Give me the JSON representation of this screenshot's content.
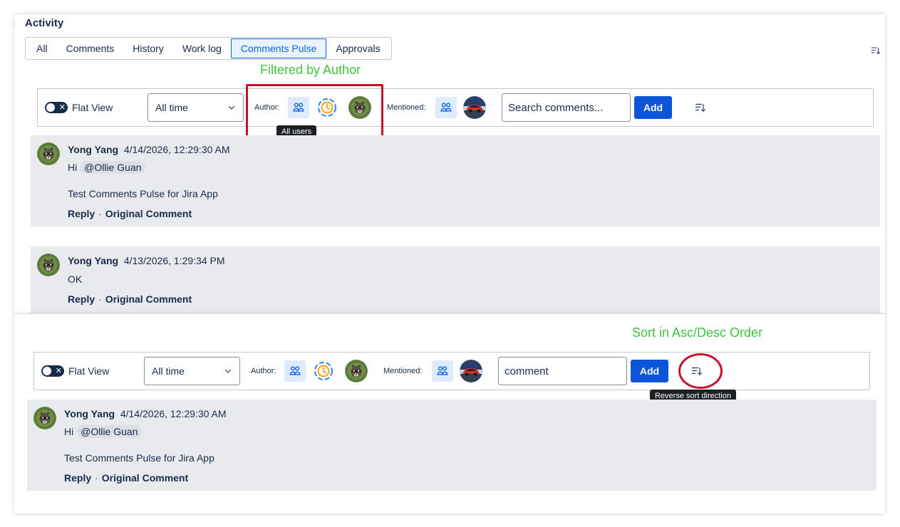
{
  "activity": {
    "title": "Activity",
    "tabs": [
      {
        "label": "All"
      },
      {
        "label": "Comments"
      },
      {
        "label": "History"
      },
      {
        "label": "Work log"
      },
      {
        "label": "Comments Pulse",
        "active": true
      },
      {
        "label": "Approvals"
      }
    ]
  },
  "annotations": {
    "filtered_by_author": "Filtered by Author",
    "sort_order": "Sort in Asc/Desc Order",
    "color": "#3ec43e",
    "highlight_color": "#c8102e"
  },
  "top": {
    "toolbar": {
      "flat_view_label": "Flat View",
      "time_filter": "All time",
      "author_label": "Author:",
      "mentioned_label": "Mentioned:",
      "search_placeholder": "Search comments...",
      "search_value": "",
      "add_label": "Add",
      "tooltip": "All users"
    },
    "comments": [
      {
        "author": "Yong Yang",
        "timestamp": "4/14/2026, 12:29:30 AM",
        "line1_prefix": "Hi ",
        "mention": "@Ollie Guan",
        "line2": "Test Comments Pulse for Jira App",
        "reply": "Reply",
        "original": "Original Comment"
      },
      {
        "author": "Yong Yang",
        "timestamp": "4/13/2026, 1:29:34 PM",
        "line1": "OK",
        "reply": "Reply",
        "original": "Original Comment"
      }
    ]
  },
  "bottom": {
    "toolbar": {
      "flat_view_label": "Flat View",
      "time_filter": "All time",
      "author_label": "Author:",
      "mentioned_label": "Mentioned:",
      "search_value": "comment",
      "add_label": "Add",
      "tooltip": "Reverse sort direction"
    },
    "comments": [
      {
        "author": "Yong Yang",
        "timestamp": "4/14/2026, 12:29:30 AM",
        "line1_prefix": "Hi ",
        "mention": "@Ollie Guan",
        "line2": "Test Comments Pulse for Jira App",
        "reply": "Reply",
        "original": "Original Comment"
      }
    ]
  },
  "colors": {
    "primary": "#0c55d8",
    "comment_bg": "#e9eaed",
    "selected_tab_bg": "#e9f2ff"
  }
}
